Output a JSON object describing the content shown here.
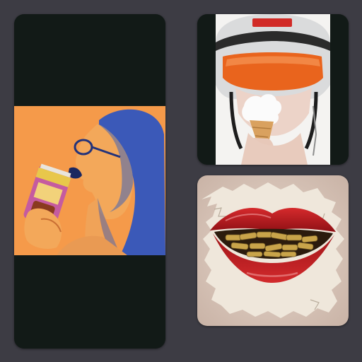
{
  "gallery": {
    "background_color": "#3d3c44",
    "tile_color": "#121a17",
    "tiles": [
      {
        "id": "woman-eating-can",
        "description_icon": "photo-woman-biting-can",
        "accent": "#f59a4a"
      },
      {
        "id": "helmet-icecream",
        "description_icon": "photo-helmet-ice-cream",
        "accent": "#e85c1e"
      },
      {
        "id": "lips-bullets",
        "description_icon": "photo-lips-bullets",
        "accent": "#b8191b"
      }
    ]
  }
}
